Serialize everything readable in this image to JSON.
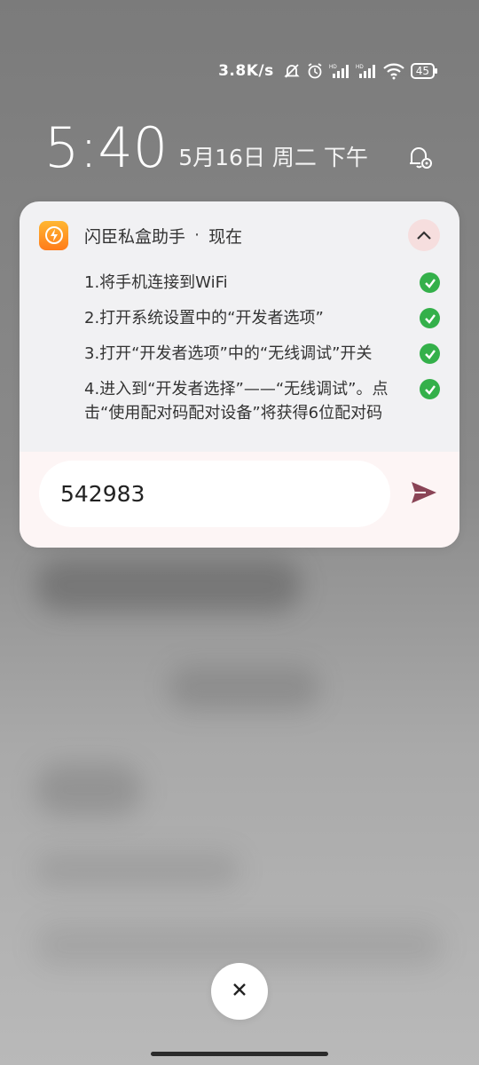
{
  "status_bar": {
    "speed": "3.8K/s",
    "icons": [
      "bell-muted-icon",
      "alarm-icon",
      "hd-signal-1-icon",
      "hd-signal-2-icon",
      "wifi-icon"
    ],
    "battery": "45"
  },
  "lock": {
    "time": "5:40",
    "date": "5月16日 周二 下午"
  },
  "notification": {
    "app_name": "闪臣私盒助手",
    "separator": "·",
    "time_label": "现在",
    "steps": [
      {
        "text": "1.将手机连接到WiFi"
      },
      {
        "text": "2.打开系统设置中的“开发者选项”"
      },
      {
        "text": "3.打开“开发者选项”中的“无线调试”开关"
      },
      {
        "text": "4.进入到“开发者选择”——“无线调试”。点击“使用配对码配对设备”将获得6位配对码"
      }
    ],
    "reply_value": "542983"
  },
  "colors": {
    "check": "#34b04a",
    "send": "#8a4456",
    "app_icon": "#ff9a22"
  }
}
